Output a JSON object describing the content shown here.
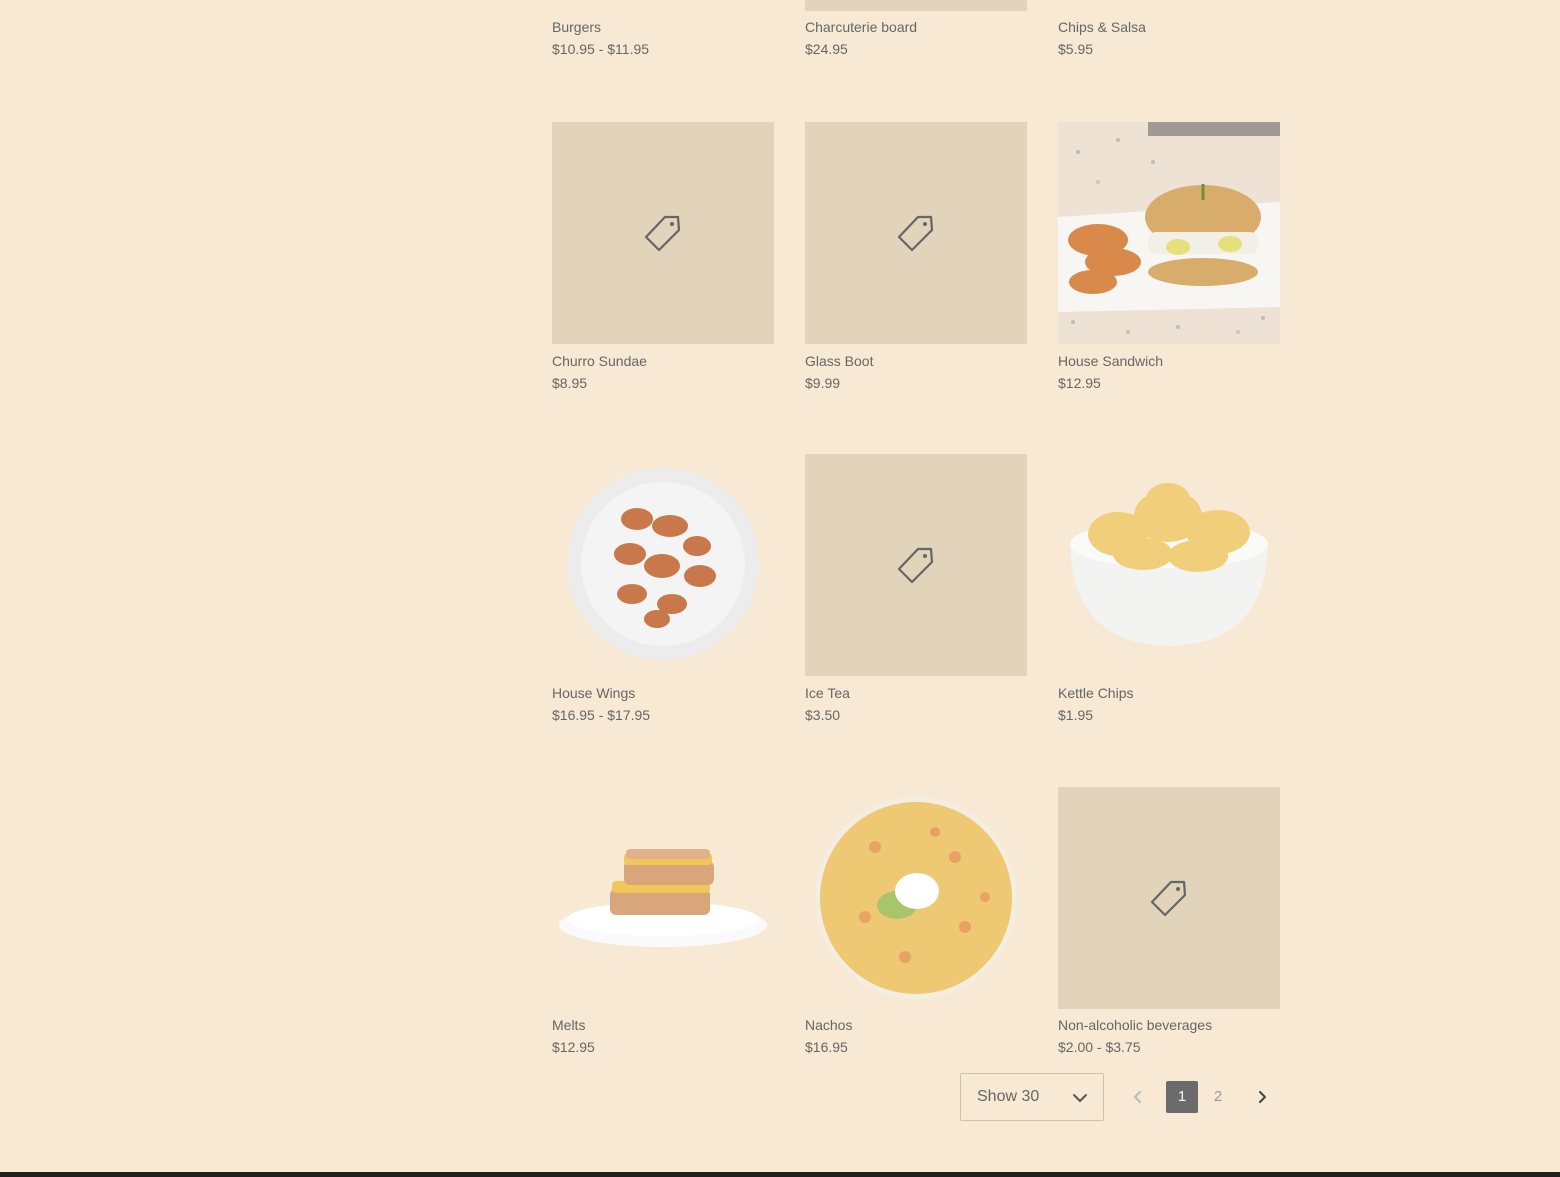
{
  "colors": {
    "background": "#f7e9d3",
    "placeholder": "#e2d3bb",
    "active_page": "#6b6b6b"
  },
  "products_top": [
    {
      "name": "Burgers",
      "price": "$10.95 - $11.95"
    },
    {
      "name": "Charcuterie board",
      "price": "$24.95"
    },
    {
      "name": "Chips & Salsa",
      "price": "$5.95"
    }
  ],
  "products": [
    {
      "name": "Churro Sundae",
      "price": "$8.95",
      "image": "tag-icon"
    },
    {
      "name": "Glass Boot",
      "price": "$9.99",
      "image": "tag-icon"
    },
    {
      "name": "House Sandwich",
      "price": "$12.95",
      "image": "sandwich-photo"
    },
    {
      "name": "House Wings",
      "price": "$16.95 - $17.95",
      "image": "wings-photo"
    },
    {
      "name": "Ice Tea",
      "price": "$3.50",
      "image": "tag-icon"
    },
    {
      "name": "Kettle Chips",
      "price": "$1.95",
      "image": "chips-photo"
    },
    {
      "name": "Melts",
      "price": "$12.95",
      "image": "melt-photo"
    },
    {
      "name": "Nachos",
      "price": "$16.95",
      "image": "nachos-photo"
    },
    {
      "name": "Non-alcoholic beverages",
      "price": "$2.00 - $3.75",
      "image": "tag-icon"
    }
  ],
  "pagination": {
    "show_label": "Show 30",
    "pages": [
      "1",
      "2"
    ],
    "current_page": "1"
  }
}
